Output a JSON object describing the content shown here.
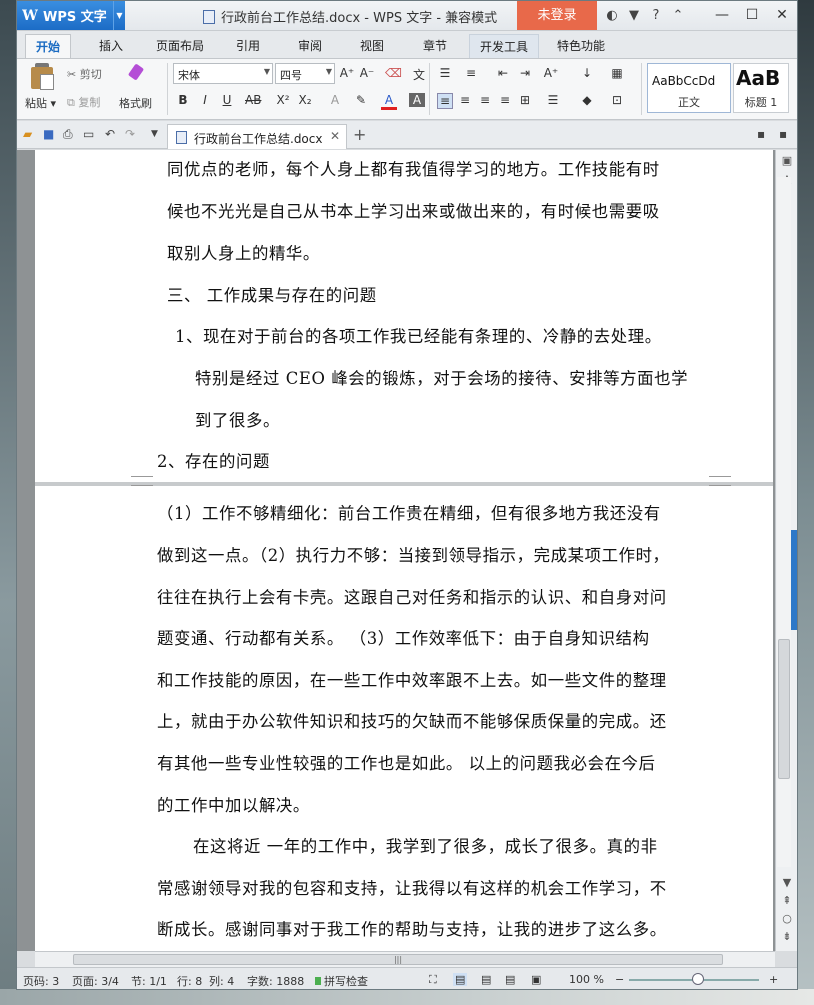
{
  "titlebar": {
    "app_name": "WPS 文字",
    "app_logo": "W",
    "document_title": "行政前台工作总结.docx - WPS 文字 - 兼容模式",
    "login_label": "未登录",
    "icons": [
      "skin-icon",
      "shirt-icon",
      "help-icon",
      "collapse-ribbon-icon"
    ],
    "glyphs": {
      "help": "?",
      "collapse": "⌃",
      "minimize": "—",
      "maximize": "☐",
      "close": "✕"
    }
  },
  "tabs": [
    {
      "label": "开始",
      "state": "active"
    },
    {
      "label": "插入"
    },
    {
      "label": "页面布局"
    },
    {
      "label": "引用"
    },
    {
      "label": "审阅"
    },
    {
      "label": "视图"
    },
    {
      "label": "章节"
    },
    {
      "label": "开发工具",
      "state": "hover"
    },
    {
      "label": "特色功能"
    }
  ],
  "ribbon": {
    "paste_label": "粘贴",
    "cut_label": "剪切",
    "copy_label": "复制",
    "format_painter_label": "格式刷",
    "font_name": "宋体",
    "font_size": "四号",
    "styles": [
      {
        "sample": "AaBbCcDd",
        "name": "正文"
      },
      {
        "sample": "AaB",
        "name": "标题 1"
      }
    ]
  },
  "quickbar": {
    "doc_tab_label": "行政前台工作总结.docx",
    "new_tab_symbol": "+"
  },
  "document": {
    "page1_lines": [
      "同优点的老师，每个人身上都有我值得学习的地方。工作技能有时",
      "候也不光光是自己从书本上学习出来或做出来的，有时候也需要吸",
      "取别人身上的精华。",
      "三、    工作成果与存在的问题",
      "1、现在对于前台的各项工作我已经能有条理的、冷静的去处理。",
      "特别是经过 CEO 峰会的锻炼，对于会场的接待、安排等方面也学",
      "到了很多。",
      "2、存在的问题"
    ],
    "page2_lines": [
      "（1）工作不够精细化：前台工作贵在精细，但有很多地方我还没有",
      "做到这一点。（2）执行力不够：当接到领导指示，完成某项工作时，",
      "往往在执行上会有卡壳。这跟自己对任务和指示的认识、和自身对问",
      "题变通、行动都有关系。    （3）工作效率低下：由于自身知识结构",
      "和工作技能的原因，在一些工作中效率跟不上去。如一些文件的整理",
      "上，就由于办公软件知识和技巧的欠缺而不能够保质保量的完成。还",
      "有其他一些专业性较强的工作也是如此。   以上的问题我必会在今后",
      "的工作中加以解决。",
      "在这将近    一年的工作中，我学到了很多，成长了很多。真的非",
      "常感谢领导对我的包容和支持，让我得以有这样的机会工作学习，不",
      "断成长。感谢同事对于我工作的帮助与支持，让我的进步了这么多。"
    ]
  },
  "statusbar": {
    "page_num": "页码: 3",
    "page_of": "页面: 3/4",
    "section": "节: 1/1",
    "row": "行: 8",
    "col": "列: 4",
    "word_count": "字数: 1888",
    "spellcheck": "拼写检查",
    "zoom": "100 %",
    "zoom_minus": "−",
    "zoom_plus": "+"
  }
}
